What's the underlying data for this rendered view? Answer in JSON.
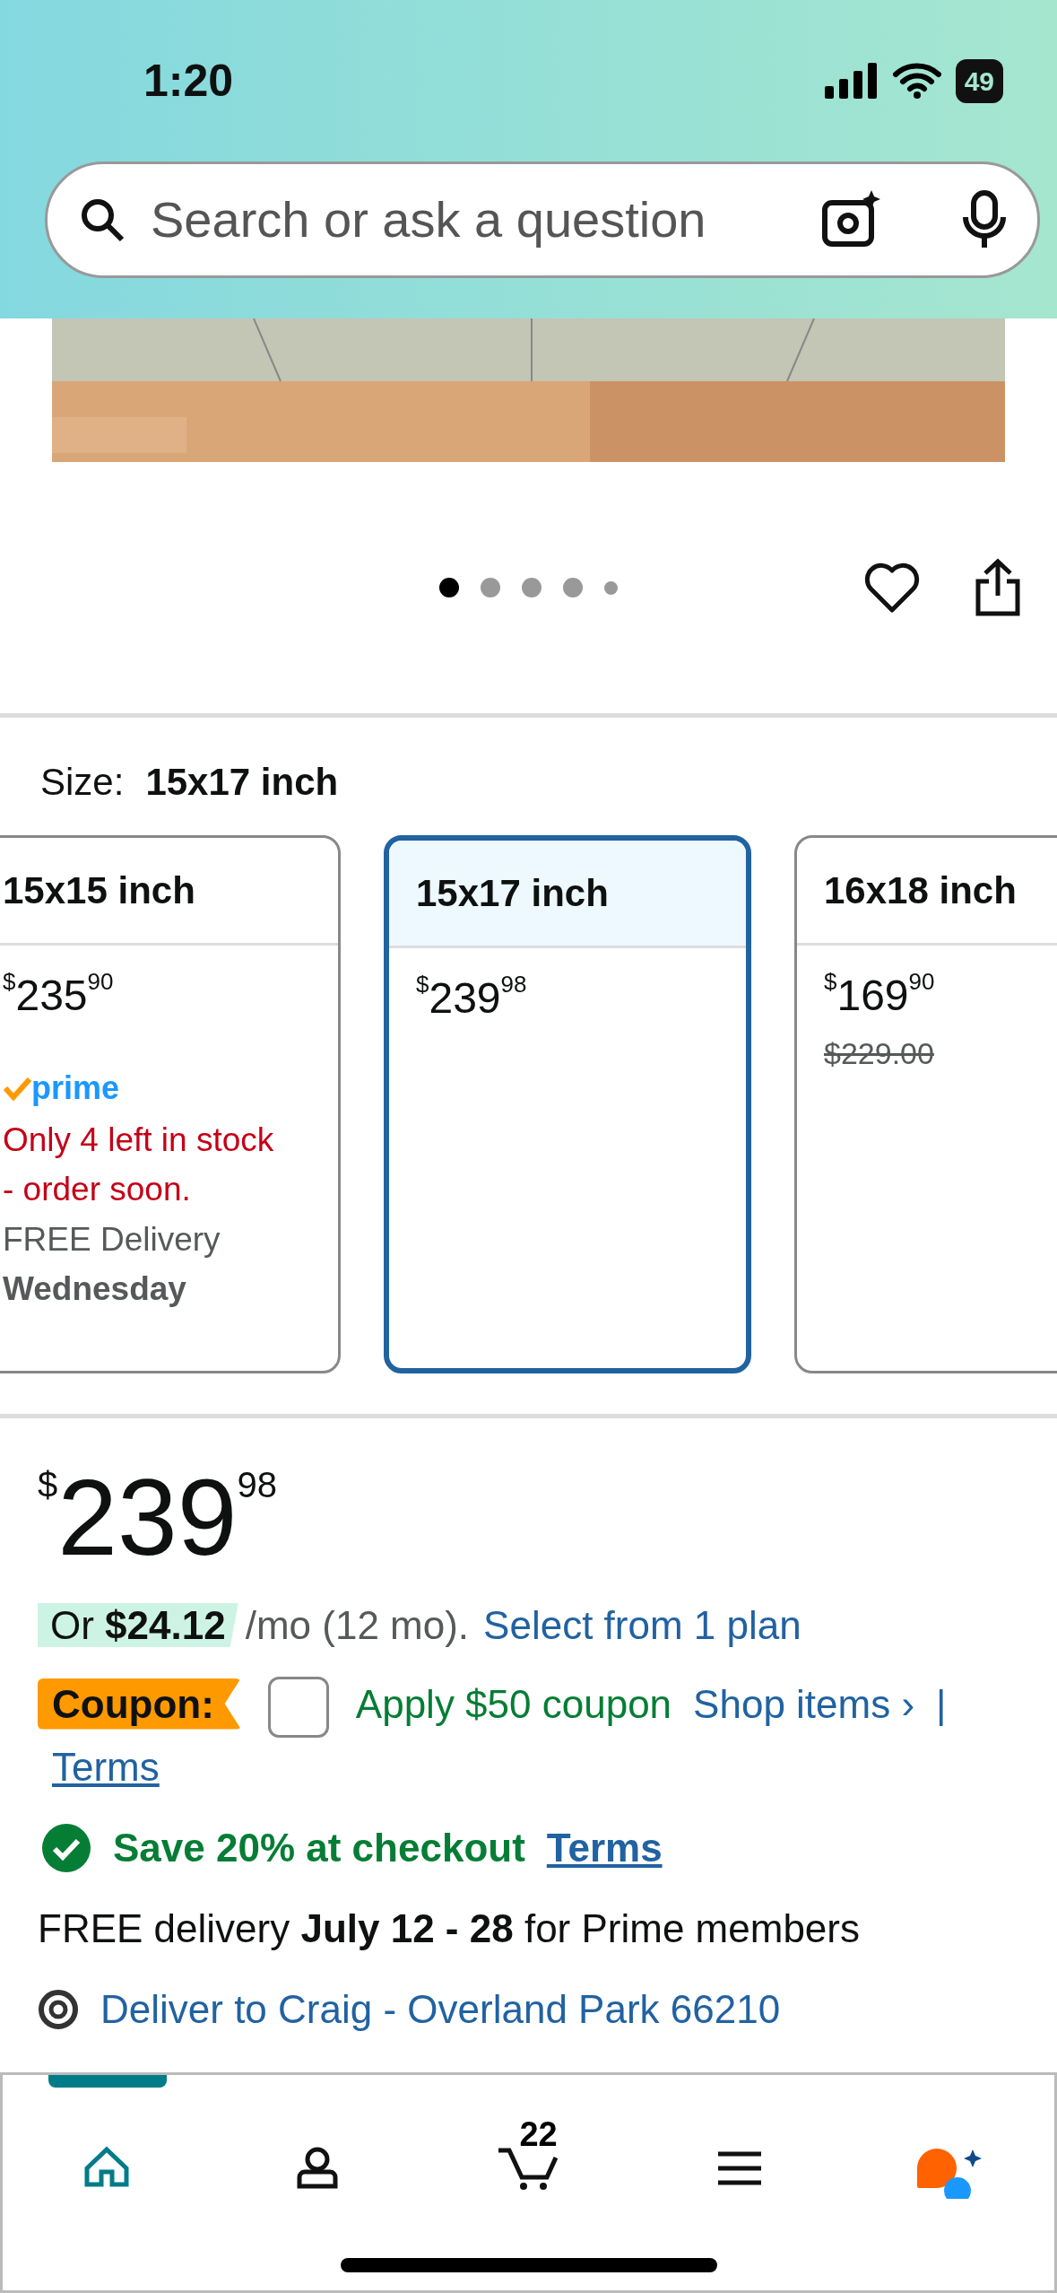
{
  "status_bar": {
    "time": "1:20",
    "battery": "49"
  },
  "search": {
    "placeholder": "Search or ask a question"
  },
  "image_dots": [
    {
      "selected": true
    },
    {
      "selected": false
    },
    {
      "selected": false
    },
    {
      "selected": false
    },
    {
      "selected": false
    }
  ],
  "size": {
    "label": "Size:",
    "value": "15x17 inch"
  },
  "size_options": [
    {
      "label": "15x15 inch",
      "selected": false,
      "price": {
        "symbol": "$",
        "whole": "235",
        "fraction": "90"
      },
      "prime": "prime",
      "stock": "Only 4 left in stock - order soon.",
      "delivery": "FREE Delivery",
      "delivery_day": "Wednesday"
    },
    {
      "label": "15x17 inch",
      "selected": true,
      "price": {
        "symbol": "$",
        "whole": "239",
        "fraction": "98"
      }
    },
    {
      "label": "16x18 inch",
      "selected": false,
      "price": {
        "symbol": "$",
        "whole": "169",
        "fraction": "90"
      },
      "list_price": "$229.00"
    }
  ],
  "price": {
    "symbol": "$",
    "whole": "239",
    "fraction": "98"
  },
  "installment": {
    "amount": "Or **$24.12**",
    "term": "/mo (12 mo).",
    "link": "Select from 1 plan"
  },
  "coupon": {
    "badge": "Coupon:",
    "checked": false,
    "label": "Apply $50 coupon",
    "shop_link": "Shop items ›",
    "separator": "|",
    "terms": "Terms"
  },
  "promotion": {
    "text": "Save 20% at checkout",
    "terms": "Terms"
  },
  "delivery": "FREE delivery **July 12 - 28** for Prime members",
  "deliver_to": "Deliver to Craig - Overland Park 66210",
  "bottom_nav": [
    {
      "kind": "home",
      "selected": true
    },
    {
      "kind": "account",
      "selected": false
    },
    {
      "kind": "cart",
      "selected": false,
      "count": "22"
    },
    {
      "kind": "menu",
      "selected": false
    },
    {
      "kind": "assistant",
      "selected": false
    }
  ]
}
